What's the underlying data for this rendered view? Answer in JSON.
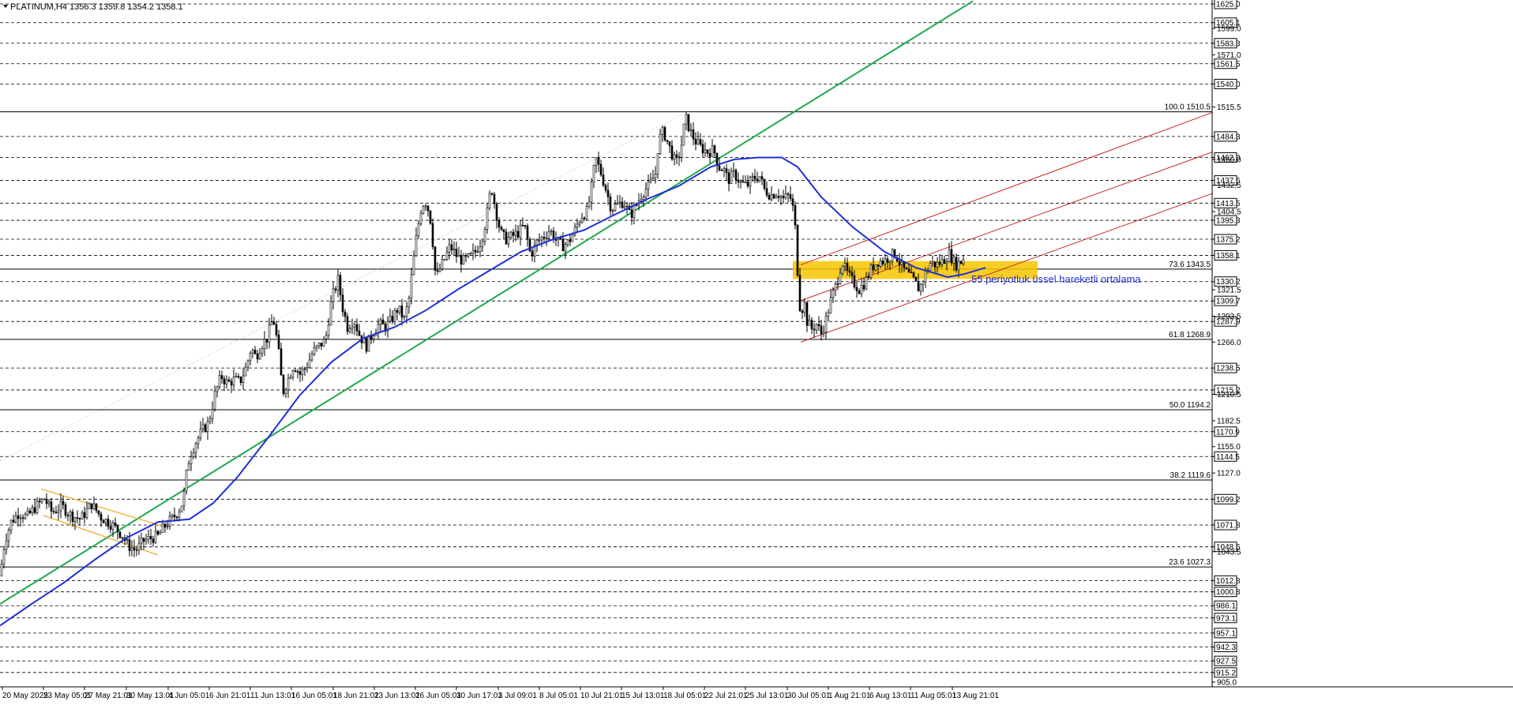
{
  "header": {
    "symbol_text": "PLATINUM,H4  1356.3 1359.8 1354.2 1358.1"
  },
  "annotation": {
    "text": "55 periyotluk üssel hareketli ortalama",
    "color": "#1f2fd6"
  },
  "colors": {
    "candle": "#000000",
    "ema": "#1f2fd6",
    "trendline": "#1fa84f",
    "channel_red": "#c62828",
    "channel_orange": "#f5a623",
    "zone": "#f7c600",
    "fib": "#000000",
    "background": "#ffffff"
  },
  "chart_data": {
    "type": "candlestick",
    "symbol": "PLATINUM",
    "timeframe": "H4",
    "ohlc": {
      "open": 1356.3,
      "high": 1359.8,
      "low": 1354.2,
      "close": 1358.1
    },
    "ylim": [
      905.0,
      1625.0
    ],
    "y_ticks": [
      1599.0,
      1571.0,
      1515.5,
      1460.0,
      1432.5,
      1404.5,
      1321.5,
      1293.5,
      1266.0,
      1210.5,
      1182.5,
      1155.0,
      1127.0,
      1043.5,
      905.0
    ],
    "level_lines": [
      1625.0,
      1605.1,
      1583.3,
      1561.5,
      1540.0,
      1484.3,
      1462.0,
      1437.6,
      1413.5,
      1395.3,
      1375.2,
      1358.1,
      1330.2,
      1309.7,
      1287.9,
      1238.5,
      1215.2,
      1170.9,
      1144.5,
      1099.2,
      1071.8,
      1048.6,
      1012.8,
      1000.8,
      986.1,
      973.1,
      957.1,
      942.3,
      927.5,
      915.2
    ],
    "highlighted_levels": [
      1625.0,
      1605.1,
      1583.3,
      1561.5,
      1540.0,
      1484.3,
      1462.0,
      1437.6,
      1413.5,
      1395.3,
      1375.2,
      1358.1,
      1330.2,
      1309.7,
      1287.9,
      1238.5,
      1215.2,
      1170.9,
      1144.5,
      1099.2,
      1071.8,
      1048.6,
      1012.8,
      1000.8,
      986.1,
      973.1,
      957.1,
      942.3,
      927.5,
      915.2
    ],
    "fibonacci": [
      {
        "text": "100.0 1510.5",
        "ratio": 100.0,
        "price": 1510.5
      },
      {
        "text": "73.6 1343.5",
        "ratio": 73.6,
        "price": 1343.5
      },
      {
        "text": "61.8 1268.9",
        "ratio": 61.8,
        "price": 1268.9
      },
      {
        "text": "50.0 1194.2",
        "ratio": 50.0,
        "price": 1194.2
      },
      {
        "text": "38.2 1119.6",
        "ratio": 38.2,
        "price": 1119.6
      },
      {
        "text": "23.6 1027.3",
        "ratio": 23.6,
        "price": 1027.3
      }
    ],
    "x_labels": [
      "20 May 2025",
      "23 May 05:01",
      "27 May 21:01",
      "30 May 13:01",
      "4 Jun 05:01",
      "6 Jun 21:01",
      "11 Jun 13:01",
      "16 Jun 05:01",
      "18 Jun 21:01",
      "23 Jun 13:01",
      "26 Jun 05:01",
      "30 Jun 17:01",
      "3 Jul 09:01",
      "8 Jul 05:01",
      "10 Jul 21:01",
      "15 Jul 13:01",
      "18 Jul 05:01",
      "22 Jul 21:01",
      "25 Jul 13:01",
      "30 Jul 05:01",
      "1 Aug 21:01",
      "6 Aug 13:01",
      "11 Aug 05:01",
      "13 Aug 21:01"
    ],
    "close_path": [
      [
        0,
        1018
      ],
      [
        6,
        1055
      ],
      [
        14,
        1075
      ],
      [
        24,
        1085
      ],
      [
        34,
        1080
      ],
      [
        44,
        1090
      ],
      [
        56,
        1100
      ],
      [
        66,
        1085
      ],
      [
        78,
        1092
      ],
      [
        90,
        1082
      ],
      [
        102,
        1078
      ],
      [
        116,
        1094
      ],
      [
        128,
        1080
      ],
      [
        142,
        1072
      ],
      [
        154,
        1062
      ],
      [
        162,
        1050
      ],
      [
        172,
        1045
      ],
      [
        182,
        1055
      ],
      [
        192,
        1058
      ],
      [
        200,
        1060
      ],
      [
        210,
        1072
      ],
      [
        220,
        1080
      ],
      [
        228,
        1090
      ],
      [
        232,
        1098
      ],
      [
        236,
        1125
      ],
      [
        240,
        1145
      ],
      [
        248,
        1160
      ],
      [
        256,
        1172
      ],
      [
        264,
        1180
      ],
      [
        272,
        1210
      ],
      [
        280,
        1230
      ],
      [
        288,
        1222
      ],
      [
        296,
        1226
      ],
      [
        304,
        1224
      ],
      [
        312,
        1240
      ],
      [
        318,
        1260
      ],
      [
        324,
        1250
      ],
      [
        330,
        1262
      ],
      [
        338,
        1270
      ],
      [
        346,
        1292
      ],
      [
        352,
        1262
      ],
      [
        358,
        1212
      ],
      [
        364,
        1225
      ],
      [
        372,
        1242
      ],
      [
        380,
        1232
      ],
      [
        388,
        1240
      ],
      [
        396,
        1255
      ],
      [
        404,
        1262
      ],
      [
        412,
        1268
      ],
      [
        420,
        1312
      ],
      [
        428,
        1332
      ],
      [
        434,
        1302
      ],
      [
        440,
        1282
      ],
      [
        448,
        1290
      ],
      [
        456,
        1272
      ],
      [
        464,
        1262
      ],
      [
        472,
        1276
      ],
      [
        480,
        1285
      ],
      [
        488,
        1282
      ],
      [
        496,
        1290
      ],
      [
        504,
        1302
      ],
      [
        512,
        1290
      ],
      [
        518,
        1312
      ],
      [
        522,
        1342
      ],
      [
        528,
        1382
      ],
      [
        534,
        1412
      ],
      [
        540,
        1415
      ],
      [
        546,
        1392
      ],
      [
        552,
        1332
      ],
      [
        556,
        1342
      ],
      [
        562,
        1352
      ],
      [
        570,
        1368
      ],
      [
        578,
        1358
      ],
      [
        586,
        1352
      ],
      [
        594,
        1355
      ],
      [
        602,
        1362
      ],
      [
        610,
        1375
      ],
      [
        616,
        1398
      ],
      [
        622,
        1432
      ],
      [
        628,
        1405
      ],
      [
        634,
        1382
      ],
      [
        640,
        1375
      ],
      [
        648,
        1378
      ],
      [
        656,
        1382
      ],
      [
        664,
        1390
      ],
      [
        672,
        1358
      ],
      [
        680,
        1372
      ],
      [
        688,
        1378
      ],
      [
        696,
        1385
      ],
      [
        704,
        1375
      ],
      [
        712,
        1368
      ],
      [
        720,
        1372
      ],
      [
        728,
        1385
      ],
      [
        736,
        1400
      ],
      [
        744,
        1405
      ],
      [
        750,
        1435
      ],
      [
        754,
        1462
      ],
      [
        760,
        1448
      ],
      [
        766,
        1432
      ],
      [
        774,
        1408
      ],
      [
        782,
        1412
      ],
      [
        790,
        1415
      ],
      [
        798,
        1400
      ],
      [
        806,
        1412
      ],
      [
        814,
        1425
      ],
      [
        822,
        1432
      ],
      [
        830,
        1445
      ],
      [
        834,
        1480
      ],
      [
        840,
        1490
      ],
      [
        848,
        1472
      ],
      [
        856,
        1455
      ],
      [
        862,
        1470
      ],
      [
        868,
        1505
      ],
      [
        874,
        1490
      ],
      [
        880,
        1480
      ],
      [
        888,
        1472
      ],
      [
        896,
        1468
      ],
      [
        904,
        1470
      ],
      [
        910,
        1452
      ],
      [
        916,
        1450
      ],
      [
        922,
        1438
      ],
      [
        930,
        1445
      ],
      [
        938,
        1435
      ],
      [
        946,
        1432
      ],
      [
        954,
        1440
      ],
      [
        962,
        1442
      ],
      [
        968,
        1428
      ],
      [
        976,
        1422
      ],
      [
        984,
        1425
      ],
      [
        992,
        1418
      ],
      [
        1000,
        1422
      ],
      [
        1006,
        1402
      ],
      [
        1010,
        1342
      ],
      [
        1014,
        1292
      ],
      [
        1018,
        1312
      ],
      [
        1022,
        1288
      ],
      [
        1028,
        1280
      ],
      [
        1034,
        1285
      ],
      [
        1040,
        1275
      ],
      [
        1046,
        1290
      ],
      [
        1052,
        1310
      ],
      [
        1060,
        1330
      ],
      [
        1066,
        1352
      ],
      [
        1072,
        1340
      ],
      [
        1080,
        1330
      ],
      [
        1088,
        1322
      ],
      [
        1096,
        1330
      ],
      [
        1104,
        1345
      ],
      [
        1112,
        1352
      ],
      [
        1120,
        1352
      ],
      [
        1128,
        1358
      ],
      [
        1134,
        1360
      ],
      [
        1142,
        1345
      ],
      [
        1150,
        1338
      ],
      [
        1158,
        1330
      ],
      [
        1164,
        1322
      ],
      [
        1170,
        1335
      ],
      [
        1178,
        1350
      ],
      [
        1186,
        1348
      ],
      [
        1194,
        1352
      ],
      [
        1202,
        1360
      ],
      [
        1210,
        1348
      ],
      [
        1218,
        1352
      ],
      [
        1222,
        1358
      ]
    ],
    "ema_path": [
      [
        0,
        965
      ],
      [
        40,
        988
      ],
      [
        80,
        1010
      ],
      [
        120,
        1035
      ],
      [
        160,
        1058
      ],
      [
        200,
        1075
      ],
      [
        240,
        1078
      ],
      [
        270,
        1095
      ],
      [
        300,
        1122
      ],
      [
        340,
        1165
      ],
      [
        380,
        1210
      ],
      [
        420,
        1245
      ],
      [
        460,
        1270
      ],
      [
        500,
        1282
      ],
      [
        540,
        1300
      ],
      [
        580,
        1322
      ],
      [
        620,
        1342
      ],
      [
        660,
        1362
      ],
      [
        700,
        1375
      ],
      [
        740,
        1385
      ],
      [
        780,
        1402
      ],
      [
        820,
        1418
      ],
      [
        860,
        1432
      ],
      [
        900,
        1452
      ],
      [
        930,
        1460
      ],
      [
        960,
        1462
      ],
      [
        990,
        1462
      ],
      [
        1010,
        1452
      ],
      [
        1040,
        1420
      ],
      [
        1080,
        1388
      ],
      [
        1120,
        1362
      ],
      [
        1160,
        1345
      ],
      [
        1200,
        1335
      ],
      [
        1220,
        1338
      ],
      [
        1248,
        1345
      ]
    ],
    "trendline_green": {
      "x1": 0,
      "y1": 988,
      "x2": 1232,
      "y2": 1628
    },
    "channel_red": [
      {
        "x1": 1014,
        "y1": 1348,
        "x2": 1536,
        "y2": 1510
      },
      {
        "x1": 1014,
        "y1": 1310,
        "x2": 1536,
        "y2": 1468
      },
      {
        "x1": 1014,
        "y1": 1266,
        "x2": 1536,
        "y2": 1424
      }
    ],
    "channel_orange": [
      {
        "x1": 52,
        "y1": 1110,
        "x2": 208,
        "y2": 1070
      },
      {
        "x1": 55,
        "y1": 1082,
        "x2": 200,
        "y2": 1040
      }
    ],
    "zone": {
      "x1": 1004,
      "x2": 1314,
      "top": 1352,
      "bottom": 1333
    },
    "dotted_trace": {
      "x1": 0,
      "y1": 1140,
      "x2": 870,
      "y2": 1510
    }
  }
}
